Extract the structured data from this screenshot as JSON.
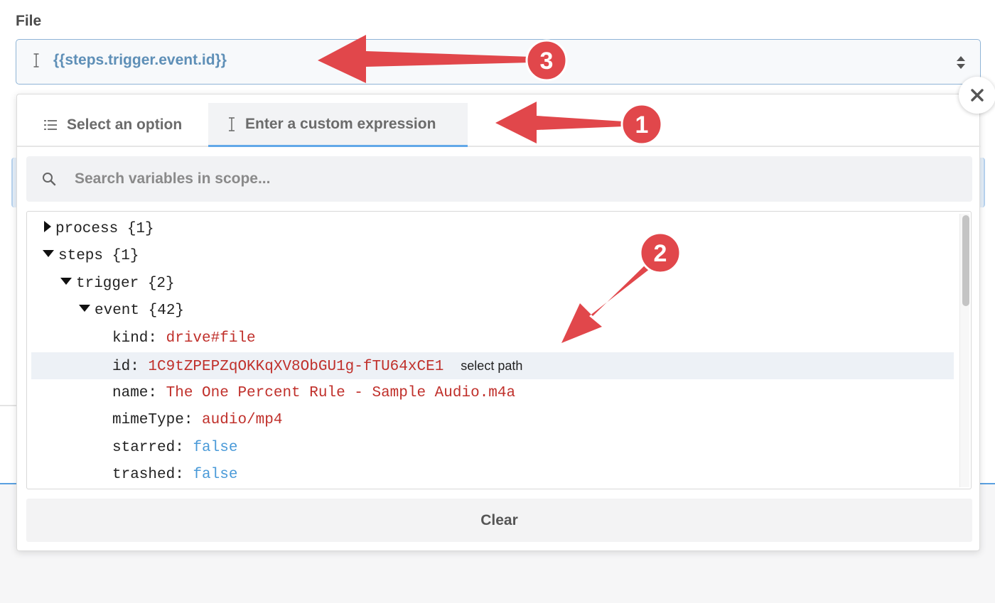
{
  "field": {
    "label": "File"
  },
  "select": {
    "value": "{{steps.trigger.event.id}}"
  },
  "tabs": [
    {
      "label": "Select an option",
      "icon": "list-icon",
      "active": false
    },
    {
      "label": "Enter a custom expression",
      "icon": "text-cursor-icon",
      "active": true
    }
  ],
  "search": {
    "placeholder": "Search variables in scope..."
  },
  "tree": {
    "process": {
      "key": "process",
      "count": "{1}"
    },
    "steps": {
      "key": "steps",
      "count": "{1}"
    },
    "trigger": {
      "key": "trigger",
      "count": "{2}"
    },
    "event": {
      "key": "event",
      "count": "{42}"
    },
    "fields": [
      {
        "key": "kind:",
        "value": "drive#file",
        "type": "string"
      },
      {
        "key": "id:",
        "value": "1C9tZPEPZqOKKqXV8ObGU1g-fTU64xCE1",
        "type": "string",
        "action": "select path"
      },
      {
        "key": "name:",
        "value": "The One Percent Rule - Sample Audio.m4a",
        "type": "string"
      },
      {
        "key": "mimeType:",
        "value": "audio/mp4",
        "type": "string"
      },
      {
        "key": "starred:",
        "value": "false",
        "type": "boolean"
      },
      {
        "key": "trashed:",
        "value": "false",
        "type": "boolean"
      }
    ]
  },
  "clear": {
    "label": "Clear"
  },
  "annotations": [
    {
      "number": "1",
      "target": "tab-custom-expression"
    },
    {
      "number": "2",
      "target": "tree-row-id"
    },
    {
      "number": "3",
      "target": "select-value"
    }
  ],
  "colors": {
    "accent": "#62a8e8",
    "string_value": "#c0302b",
    "boolean_value": "#4a9ad8",
    "annotation": "#e1474b"
  },
  "icons": {
    "select_cursor": "text-cursor-icon",
    "select_sort": "sort-arrows-icon",
    "search": "search-icon",
    "close": "close-icon"
  }
}
